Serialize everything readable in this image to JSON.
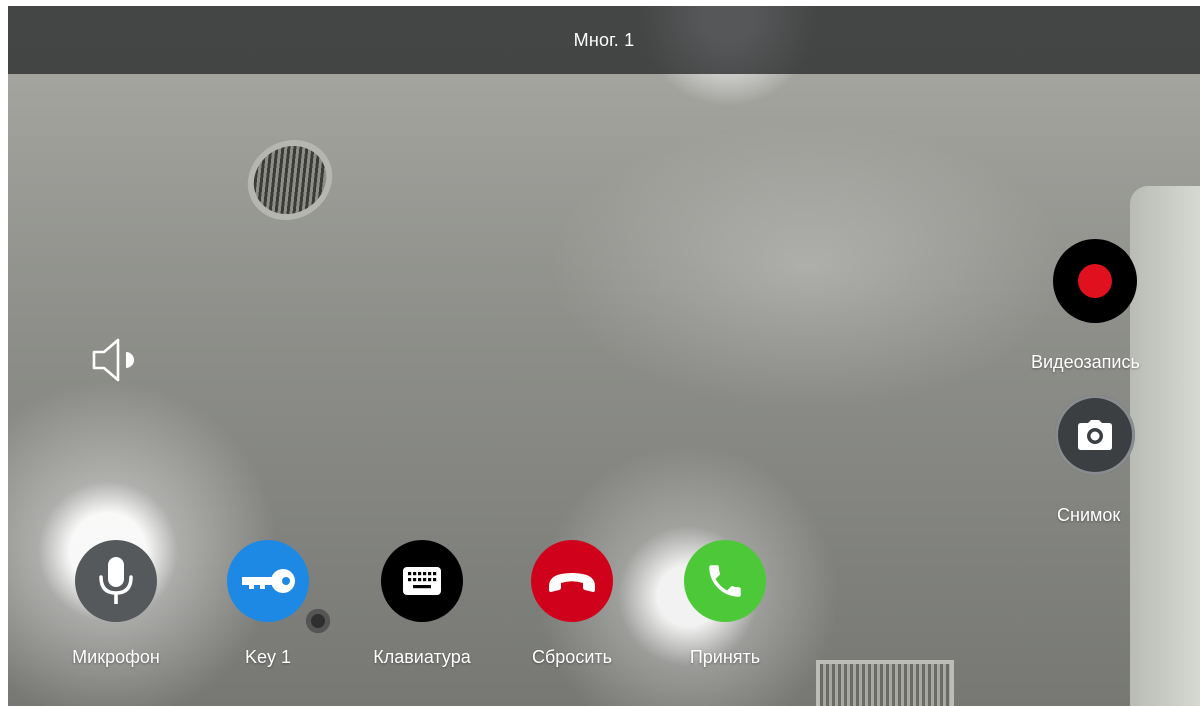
{
  "header": {
    "title": "Мног. 1"
  },
  "call_controls": [
    {
      "id": "microphone",
      "label": "Микрофон",
      "icon": "microphone-icon",
      "color": "#55595c"
    },
    {
      "id": "key1",
      "label": "Key 1",
      "icon": "key-icon",
      "color": "#1e88e5"
    },
    {
      "id": "keyboard",
      "label": "Клавиатура",
      "icon": "keyboard-icon",
      "color": "#000000"
    },
    {
      "id": "reset",
      "label": "Сбросить",
      "icon": "hang-up-icon",
      "color": "#d0021b"
    },
    {
      "id": "accept",
      "label": "Принять",
      "icon": "phone-icon",
      "color": "#4cc838"
    }
  ],
  "side_controls": {
    "record": {
      "label": "Видеозапись",
      "icon": "record-icon",
      "color": "#e0101e"
    },
    "snapshot": {
      "label": "Снимок",
      "icon": "camera-icon"
    }
  },
  "volume": {
    "icon": "speaker-icon"
  }
}
